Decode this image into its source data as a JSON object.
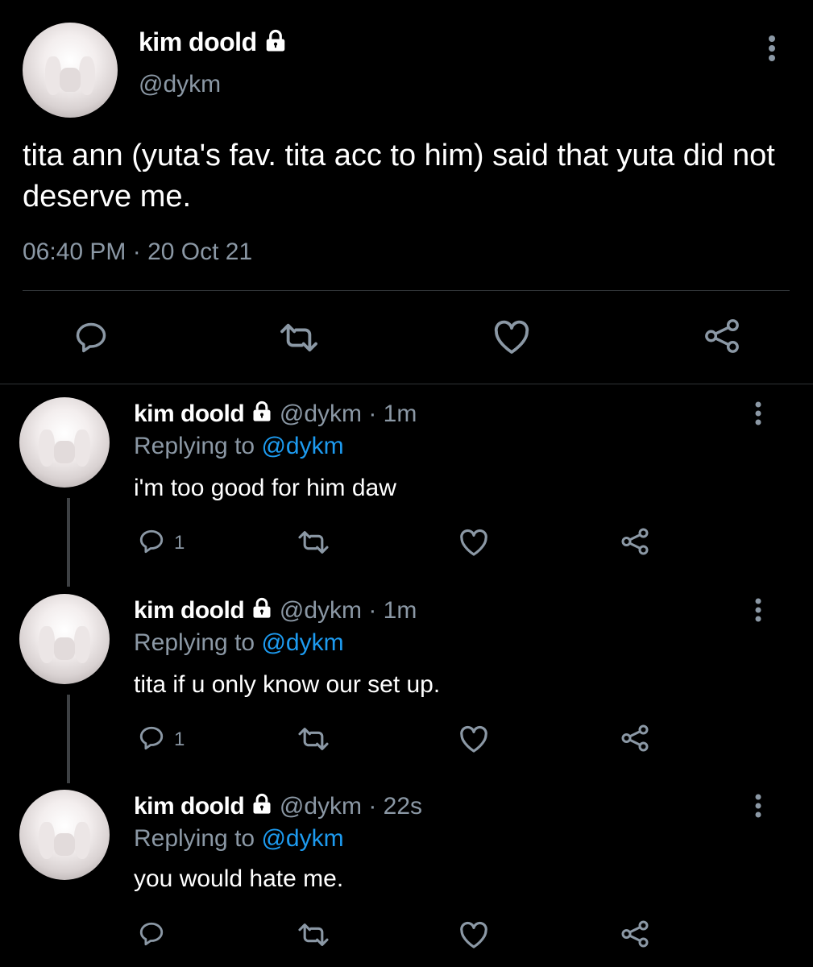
{
  "main_tweet": {
    "name": "kim doold",
    "handle": "@dykm",
    "text": "tita ann (yuta's fav. tita acc to him) said that yuta did not deserve me.",
    "timestamp": "06:40 PM · 20 Oct 21",
    "icons": [
      "reply-icon",
      "retweet-icon",
      "like-icon",
      "share-icon",
      "more-icon",
      "lock-icon"
    ]
  },
  "replies": [
    {
      "name": "kim doold",
      "meta": "@dykm · 1m",
      "replying_prefix": "Replying to ",
      "replying_handle": "@dykm",
      "text": "i'm too good for him daw",
      "reply_count": "1"
    },
    {
      "name": "kim doold",
      "meta": "@dykm · 1m",
      "replying_prefix": "Replying to ",
      "replying_handle": "@dykm",
      "text": "tita if u only know our set up.",
      "reply_count": "1"
    },
    {
      "name": "kim doold",
      "meta": "@dykm · 22s",
      "replying_prefix": "Replying to ",
      "replying_handle": "@dykm",
      "text": "you would hate me.",
      "reply_count": ""
    }
  ],
  "colors": {
    "background": "#000000",
    "text": "#ffffff",
    "muted": "#8b98a5",
    "link": "#1d9bf0",
    "divider": "#2f3336"
  }
}
